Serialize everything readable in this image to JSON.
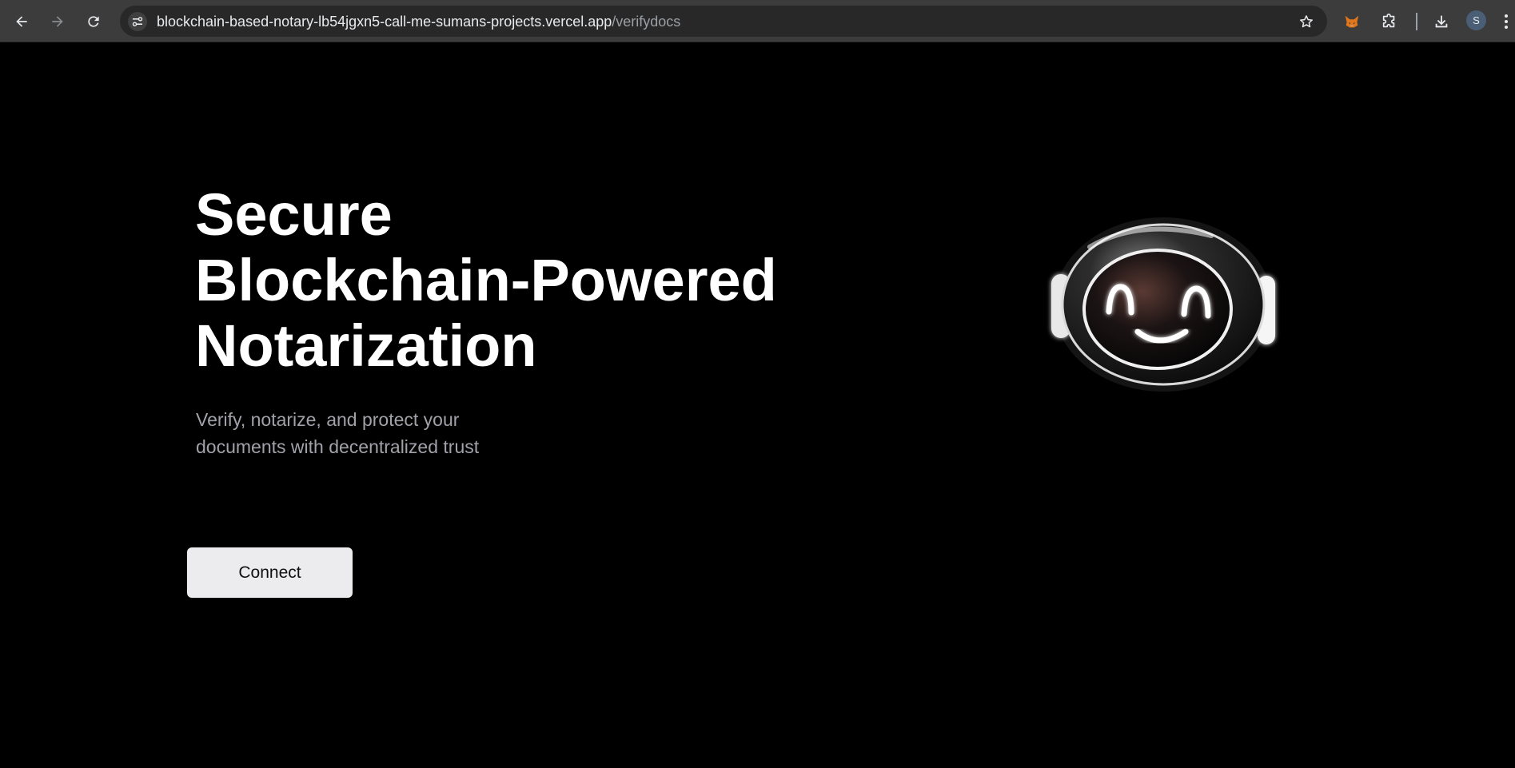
{
  "browser": {
    "url_host": "blockchain-based-notary-lb54jgxn5-call-me-sumans-projects.vercel.app",
    "url_path": "/verifydocs",
    "profile_initial": "S",
    "icons": {
      "back": "arrow-left-icon",
      "forward": "arrow-right-icon",
      "reload": "reload-icon",
      "site_info": "tune-icon",
      "bookmark": "star-icon",
      "extension_fox": "fox-extension-icon",
      "extensions": "puzzle-icon",
      "downloads": "download-icon",
      "menu": "kebab-menu-icon"
    }
  },
  "hero": {
    "title_lines": [
      "Secure",
      "Blockchain-Powered",
      "Notarization"
    ],
    "subtitle_lines": [
      "Verify, notarize, and protect your",
      "documents with decentralized trust"
    ],
    "connect_label": "Connect",
    "mascot_icon": "robot-mascot-icon"
  },
  "colors": {
    "page_bg": "#000000",
    "title": "#ffffff",
    "subtitle": "#a1a1aa",
    "button_bg": "#ececef",
    "browser_bar": "#3c3c3c",
    "omnibox": "#282828"
  }
}
